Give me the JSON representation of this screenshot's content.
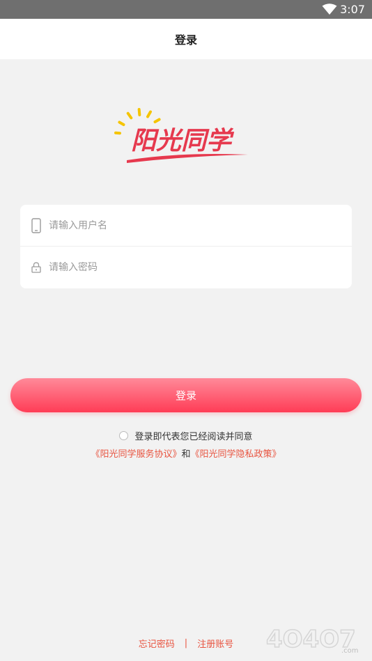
{
  "status_bar": {
    "time": "3:07",
    "wifi_icon": "wifi-icon"
  },
  "nav": {
    "title": "登录"
  },
  "logo": {
    "text": "阳光同学"
  },
  "form": {
    "username": {
      "placeholder": "请输入用户名",
      "value": "",
      "icon": "phone-icon"
    },
    "password": {
      "placeholder": "请输入密码",
      "value": "",
      "icon": "lock-icon"
    }
  },
  "login_button": {
    "label": "登录"
  },
  "agreement": {
    "text": "登录即代表您已经阅读并同意",
    "service_link": "《阳光同学服务协议》",
    "and": "和",
    "privacy_link": "《阳光同学隐私政策》"
  },
  "footer": {
    "forgot_password": "忘记密码",
    "separator": "|",
    "register": "注册账号"
  },
  "watermark": {
    "text": "4O4O7.com"
  },
  "colors": {
    "accent": "#ff4d63",
    "link": "#e8533f",
    "logo_red": "#e6394e",
    "logo_sun": "#f5c400"
  }
}
